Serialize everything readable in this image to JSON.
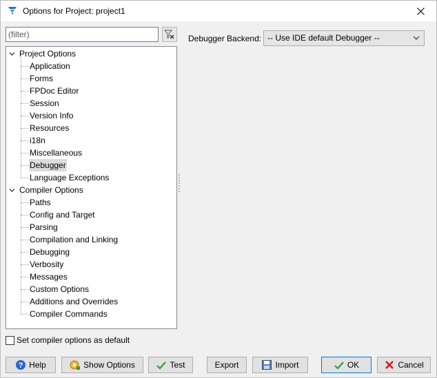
{
  "window": {
    "title": "Options for Project: project1",
    "close_icon": "close-icon"
  },
  "filter": {
    "placeholder": "(filter)"
  },
  "tree": {
    "groups": [
      {
        "label": "Project Options",
        "items": [
          "Application",
          "Forms",
          "FPDoc Editor",
          "Session",
          "Version Info",
          "Resources",
          "i18n",
          "Miscellaneous",
          "Debugger",
          "Language Exceptions"
        ]
      },
      {
        "label": "Compiler Options",
        "items": [
          "Paths",
          "Config and Target",
          "Parsing",
          "Compilation and Linking",
          "Debugging",
          "Verbosity",
          "Messages",
          "Custom Options",
          "Additions and Overrides",
          "Compiler Commands"
        ]
      }
    ],
    "selected": "Debugger"
  },
  "debugger": {
    "backend_label": "Debugger Backend:",
    "backend_value": "-- Use IDE default Debugger --"
  },
  "footer": {
    "default_checkbox_label": "Set compiler options as default",
    "default_checked": false,
    "help": "Help",
    "show_options": "Show Options",
    "test": "Test",
    "export": "Export",
    "import": "Import",
    "ok": "OK",
    "cancel": "Cancel"
  },
  "colors": {
    "ok_green": "#2e9e3e",
    "cancel_red": "#d11a1a",
    "help_blue": "#2b66c8",
    "focus_border": "#0078d7"
  }
}
